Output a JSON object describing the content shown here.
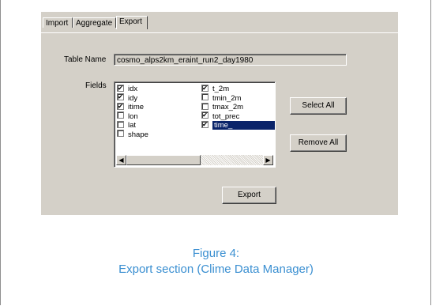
{
  "tabs": [
    {
      "label": "Import",
      "active": false
    },
    {
      "label": "Aggregate",
      "active": false
    },
    {
      "label": "Export",
      "active": true
    }
  ],
  "form": {
    "table_name_label": "Table Name",
    "table_name_value": "cosmo_alps2km_eraint_run2_day1980",
    "fields_label": "Fields"
  },
  "fields_left": [
    {
      "name": "idx",
      "checked": true
    },
    {
      "name": "idy",
      "checked": true
    },
    {
      "name": "itime",
      "checked": true
    },
    {
      "name": "lon",
      "checked": false
    },
    {
      "name": "lat",
      "checked": false
    },
    {
      "name": "shape",
      "checked": false
    }
  ],
  "fields_right": [
    {
      "name": "t_2m",
      "checked": true
    },
    {
      "name": "tmin_2m",
      "checked": false
    },
    {
      "name": "tmax_2m",
      "checked": false
    },
    {
      "name": "tot_prec",
      "checked": true
    },
    {
      "name": "time_",
      "checked": true,
      "selected": true
    }
  ],
  "buttons": {
    "select_all": "Select All",
    "remove_all": "Remove All",
    "export": "Export"
  },
  "caption": {
    "line1": "Figure 4:",
    "line2": "Export section (Clime Data Manager)"
  },
  "colors": {
    "dialog_bg": "#d4d0c8",
    "selection": "#0a246a",
    "caption": "#3a8fd1"
  }
}
